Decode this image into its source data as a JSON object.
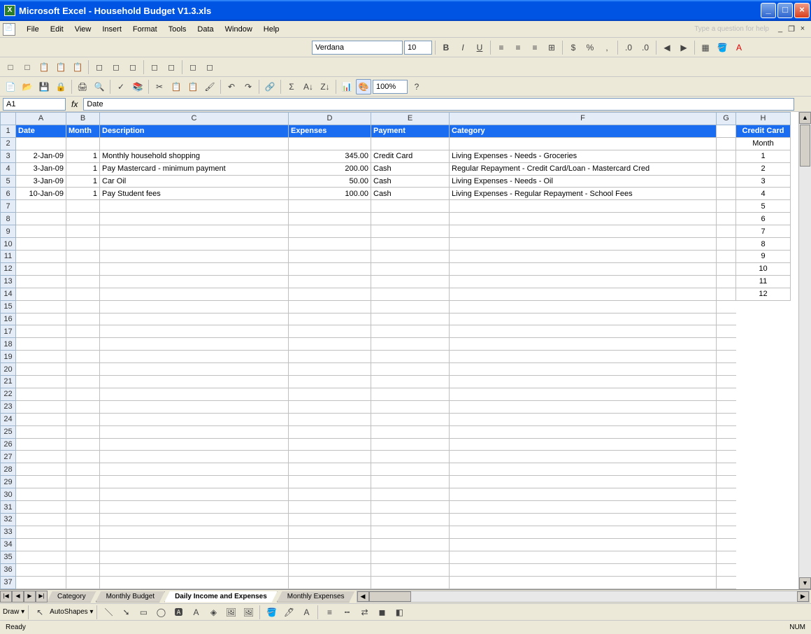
{
  "titlebar": {
    "app": "Microsoft Excel",
    "doc": "Household Budget V1.3.xls"
  },
  "menu": {
    "file": "File",
    "edit": "Edit",
    "view": "View",
    "insert": "Insert",
    "format": "Format",
    "tools": "Tools",
    "data": "Data",
    "window": "Window",
    "help": "Help",
    "helpbox": "Type a question for help"
  },
  "format_toolbar": {
    "font": "Verdana",
    "size": "10"
  },
  "standard_toolbar": {
    "zoom": "100%"
  },
  "namebox": {
    "cell": "A1",
    "formula": "Date"
  },
  "columns": [
    "A",
    "B",
    "C",
    "D",
    "E",
    "F",
    "G",
    "H"
  ],
  "headers": {
    "date": "Date",
    "month": "Month",
    "description": "Description",
    "expenses": "Expenses",
    "payment": "Payment",
    "category": "Category",
    "creditcard": "Credit Card",
    "monthlabel": "Month"
  },
  "rows": [
    {
      "date": "2-Jan-09",
      "month": "1",
      "desc": "Monthly household shopping",
      "exp": "345.00",
      "pay": "Credit Card",
      "cat": "Living Expenses - Needs - Groceries"
    },
    {
      "date": "3-Jan-09",
      "month": "1",
      "desc": "Pay Mastercard - minimum payment",
      "exp": "200.00",
      "pay": "Cash",
      "cat": "Regular Repayment - Credit Card/Loan - Mastercard Cred"
    },
    {
      "date": "3-Jan-09",
      "month": "1",
      "desc": "Car Oil",
      "exp": "50.00",
      "pay": "Cash",
      "cat": "Living Expenses - Needs - Oil"
    },
    {
      "date": "10-Jan-09",
      "month": "1",
      "desc": "Pay Student fees",
      "exp": "100.00",
      "pay": "Cash",
      "cat": "Living Expenses - Regular Repayment - School Fees"
    }
  ],
  "months": [
    "1",
    "2",
    "3",
    "4",
    "5",
    "6",
    "7",
    "8",
    "9",
    "10",
    "11",
    "12"
  ],
  "tabs": {
    "category": "Category",
    "monthly_budget": "Monthly Budget",
    "daily": "Daily Income and Expenses",
    "monthly_exp": "Monthly Expenses"
  },
  "draw": {
    "label": "Draw",
    "autoshapes": "AutoShapes"
  },
  "status": {
    "ready": "Ready",
    "num": "NUM"
  }
}
